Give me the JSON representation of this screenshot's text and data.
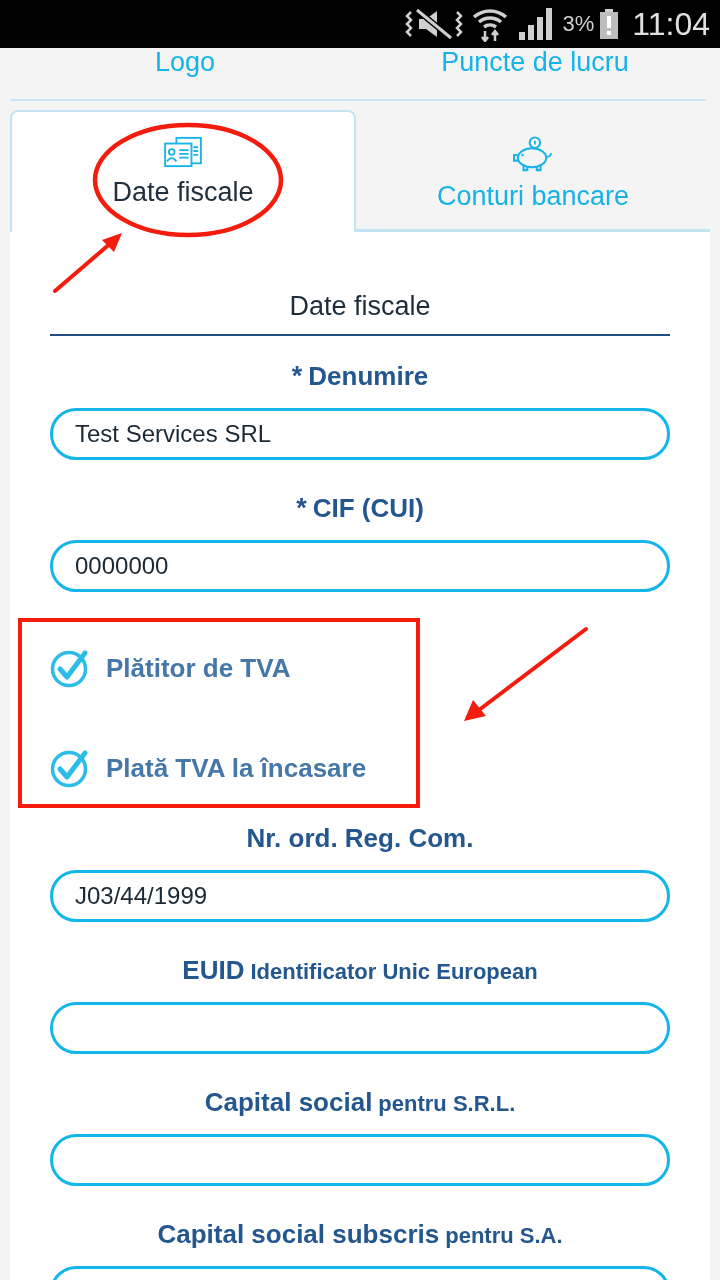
{
  "status_bar": {
    "battery": "3%",
    "time": "11:04"
  },
  "top_links": [
    {
      "label": "Logo"
    },
    {
      "label": "Puncte de lucru"
    }
  ],
  "tabs": [
    {
      "label": "Date fiscale",
      "selected": true,
      "circled": true
    },
    {
      "label": "Conturi bancare",
      "selected": false
    }
  ],
  "section": {
    "title": "Date fiscale"
  },
  "form": [
    {
      "kind": "input",
      "marker": "*",
      "label": "Denumire",
      "value": "Test Services SRL"
    },
    {
      "kind": "input",
      "marker": "*",
      "label": "CIF (CUI)",
      "value": "0000000"
    },
    {
      "kind": "checkbox_group",
      "boxed": true,
      "options": [
        {
          "label": "Plătitor de TVA",
          "checked": true
        },
        {
          "label": "Plată TVA la încasare",
          "checked": true
        }
      ]
    },
    {
      "kind": "input",
      "label": "Nr. ord. Reg. Com.",
      "value": "J03/44/1999"
    },
    {
      "kind": "input",
      "label": "EUID",
      "note": "Identificator Unic European"
    },
    {
      "kind": "input",
      "label": "Capital social",
      "note": "pentru S.R.L."
    },
    {
      "kind": "input",
      "label": "Capital social subscris",
      "note": "pentru S.A."
    }
  ]
}
